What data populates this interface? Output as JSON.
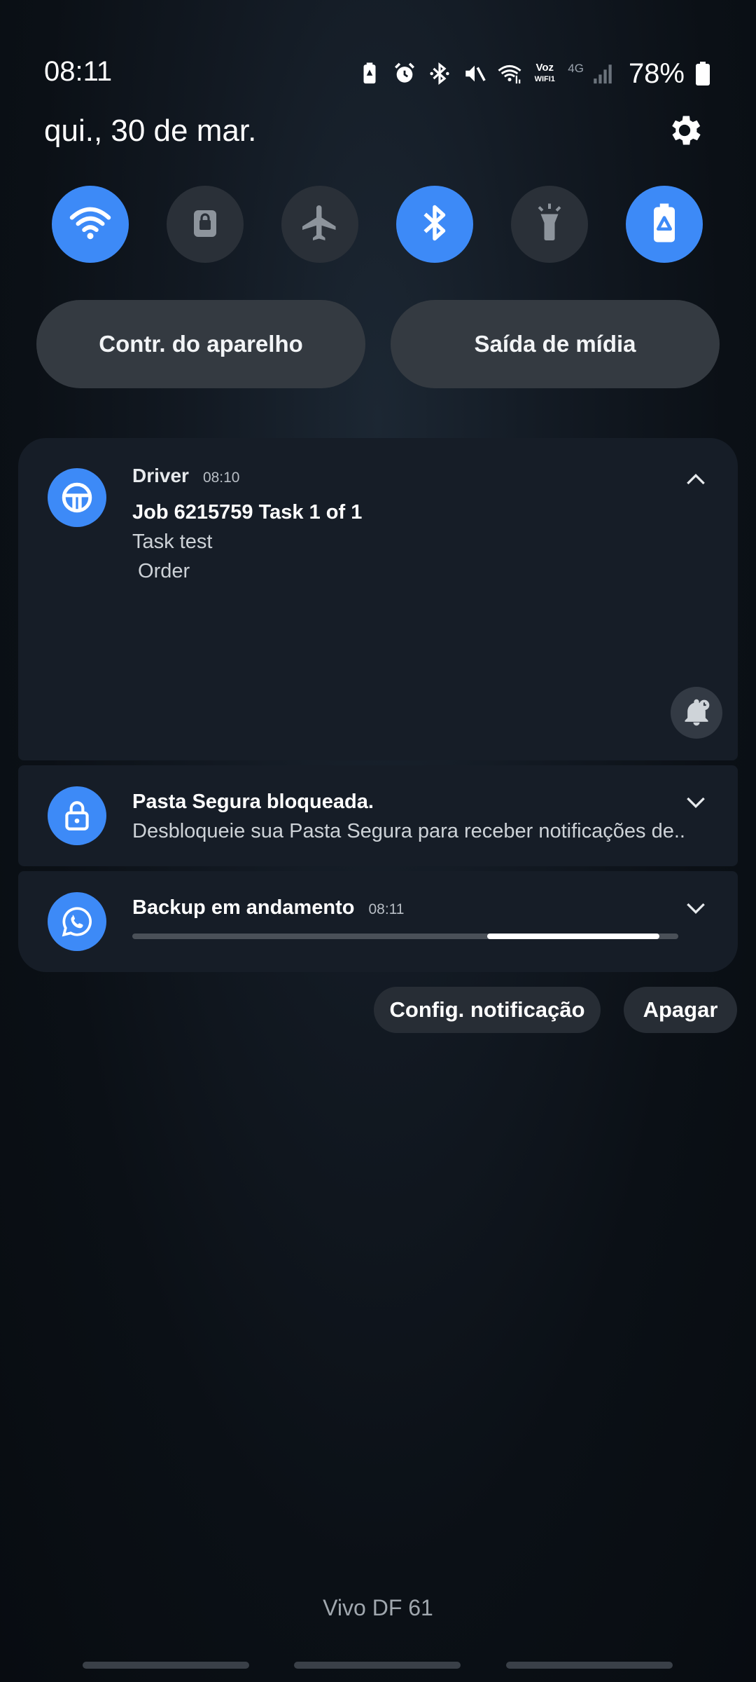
{
  "status_bar": {
    "time": "08:11",
    "voz_line1": "Voz",
    "voz_line2": "WIFI1",
    "network": "4G",
    "battery": "78%"
  },
  "date": "qui., 30 de mar.",
  "quick_toggles": [
    {
      "name": "wifi",
      "icon": "wifi-icon",
      "on": true
    },
    {
      "name": "secure-folder",
      "icon": "lock-icon",
      "on": false
    },
    {
      "name": "airplane",
      "icon": "airplane-icon",
      "on": false
    },
    {
      "name": "bluetooth",
      "icon": "bluetooth-icon",
      "on": true
    },
    {
      "name": "flashlight",
      "icon": "flashlight-icon",
      "on": false
    },
    {
      "name": "power-saving",
      "icon": "battery-recycle-icon",
      "on": true
    }
  ],
  "panel_buttons": {
    "device_control": "Contr. do aparelho",
    "media_output": "Saída de mídia"
  },
  "notifications": {
    "driver": {
      "app": "Driver",
      "time": "08:10",
      "title": "Job 6215759 Task 1 of 1",
      "line1": "Task test",
      "line2": " Order"
    },
    "pasta": {
      "title": "Pasta Segura bloqueada.",
      "body": "Desbloqueie sua Pasta Segura para receber notificações de.."
    },
    "backup": {
      "title": "Backup em andamento",
      "time": "08:11",
      "progress_start": 0.65,
      "progress_end": 0.965
    }
  },
  "actions": {
    "settings": "Config. notificação",
    "clear": "Apagar"
  },
  "carrier": "Vivo DF 61",
  "colors": {
    "accent": "#3d8af7",
    "toggle_off": "#2a3038",
    "card": "#161d27"
  }
}
